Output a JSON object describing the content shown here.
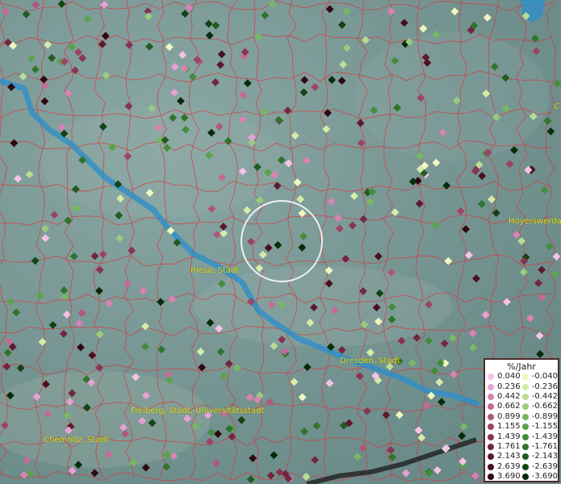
{
  "legend": {
    "title": "%/Jahr",
    "rising": [
      {
        "label": "0.040",
        "color": "#f6c2e8"
      },
      {
        "label": "0.236",
        "color": "#eaa0d4"
      },
      {
        "label": "0.442",
        "color": "#d982b4"
      },
      {
        "label": "0.662",
        "color": "#c56a96"
      },
      {
        "label": "0.899",
        "color": "#b0567e"
      },
      {
        "label": "1.155",
        "color": "#9c4468"
      },
      {
        "label": "1.439",
        "color": "#883454"
      },
      {
        "label": "1.761",
        "color": "#742640"
      },
      {
        "label": "2.143",
        "color": "#5e1a2e"
      },
      {
        "label": "2.639",
        "color": "#48101e"
      },
      {
        "label": "3.690",
        "color": "#300810"
      }
    ],
    "falling": [
      {
        "label": "-0.040",
        "color": "#f0f8c0"
      },
      {
        "label": "-0.236",
        "color": "#d6ecaa"
      },
      {
        "label": "-0.442",
        "color": "#b8de94"
      },
      {
        "label": "-0.662",
        "color": "#98cc7c"
      },
      {
        "label": "-0.899",
        "color": "#78b864"
      },
      {
        "label": "-1.155",
        "color": "#5ca24e"
      },
      {
        "label": "-1.439",
        "color": "#448c3c"
      },
      {
        "label": "-1.761",
        "color": "#30742c"
      },
      {
        "label": "-2.143",
        "color": "#205c20"
      },
      {
        "label": "-2.639",
        "color": "#124414"
      },
      {
        "label": "-3.690",
        "color": "#072c0a"
      }
    ]
  },
  "cities": [
    {
      "name": "Riesa, Stadt"
    },
    {
      "name": "Dresden, Stadt"
    },
    {
      "name": "Hoyerswerda"
    },
    {
      "name": "Freiberg, Stadt, Universitätsstadt"
    },
    {
      "name": "Chemnitz, Stadt"
    },
    {
      "name": "C"
    }
  ],
  "colors": {
    "boundary": "#d8383e",
    "river": "#2f8fc8",
    "terrain": "#6f8f8c",
    "highlight_ring": "#ffffff"
  }
}
